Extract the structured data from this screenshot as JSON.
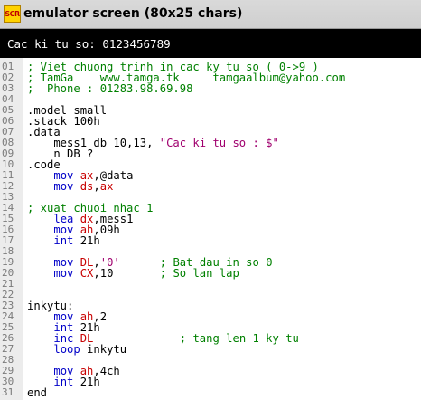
{
  "window": {
    "icon_text": "SCR",
    "title": "emulator screen (80x25 chars)"
  },
  "console": {
    "output": "Cac ki tu so: 0123456789"
  },
  "editor": {
    "lines": [
      {
        "n": "01",
        "tokens": [
          {
            "t": "; Viet chuong trinh in cac ky tu so ( 0->9 )",
            "c": "cmt"
          }
        ]
      },
      {
        "n": "02",
        "tokens": [
          {
            "t": "; TamGa    www.tamga.tk     tamgaalbum@yahoo.com",
            "c": "cmt"
          }
        ]
      },
      {
        "n": "03",
        "tokens": [
          {
            "t": ";  Phone : 01283.98.69.98",
            "c": "cmt"
          }
        ]
      },
      {
        "n": "04",
        "tokens": []
      },
      {
        "n": "05",
        "tokens": [
          {
            "t": ".model small",
            "c": "plain"
          }
        ]
      },
      {
        "n": "06",
        "tokens": [
          {
            "t": ".stack 100h",
            "c": "plain"
          }
        ]
      },
      {
        "n": "07",
        "tokens": [
          {
            "t": ".data",
            "c": "plain"
          }
        ]
      },
      {
        "n": "08",
        "tokens": [
          {
            "t": "    mess1 db 10,13, ",
            "c": "plain"
          },
          {
            "t": "\"Cac ki tu so : $\"",
            "c": "str"
          }
        ]
      },
      {
        "n": "09",
        "tokens": [
          {
            "t": "    n DB ?",
            "c": "plain"
          }
        ]
      },
      {
        "n": "10",
        "tokens": [
          {
            "t": ".code",
            "c": "plain"
          }
        ]
      },
      {
        "n": "11",
        "tokens": [
          {
            "t": "    ",
            "c": "plain"
          },
          {
            "t": "mov",
            "c": "kw"
          },
          {
            "t": " ",
            "c": "plain"
          },
          {
            "t": "ax",
            "c": "reg"
          },
          {
            "t": ",@data",
            "c": "plain"
          }
        ]
      },
      {
        "n": "12",
        "tokens": [
          {
            "t": "    ",
            "c": "plain"
          },
          {
            "t": "mov",
            "c": "kw"
          },
          {
            "t": " ",
            "c": "plain"
          },
          {
            "t": "ds",
            "c": "reg"
          },
          {
            "t": ",",
            "c": "plain"
          },
          {
            "t": "ax",
            "c": "reg"
          }
        ]
      },
      {
        "n": "13",
        "tokens": []
      },
      {
        "n": "14",
        "tokens": [
          {
            "t": "; xuat chuoi nhac 1",
            "c": "cmt"
          }
        ]
      },
      {
        "n": "15",
        "tokens": [
          {
            "t": "    ",
            "c": "plain"
          },
          {
            "t": "lea",
            "c": "kw"
          },
          {
            "t": " ",
            "c": "plain"
          },
          {
            "t": "dx",
            "c": "reg"
          },
          {
            "t": ",mess1",
            "c": "plain"
          }
        ]
      },
      {
        "n": "16",
        "tokens": [
          {
            "t": "    ",
            "c": "plain"
          },
          {
            "t": "mov",
            "c": "kw"
          },
          {
            "t": " ",
            "c": "plain"
          },
          {
            "t": "ah",
            "c": "reg"
          },
          {
            "t": ",09h",
            "c": "plain"
          }
        ]
      },
      {
        "n": "17",
        "tokens": [
          {
            "t": "    ",
            "c": "plain"
          },
          {
            "t": "int",
            "c": "kw"
          },
          {
            "t": " 21h",
            "c": "plain"
          }
        ]
      },
      {
        "n": "18",
        "tokens": []
      },
      {
        "n": "19",
        "tokens": [
          {
            "t": "    ",
            "c": "plain"
          },
          {
            "t": "mov",
            "c": "kw"
          },
          {
            "t": " ",
            "c": "plain"
          },
          {
            "t": "DL",
            "c": "reg"
          },
          {
            "t": ",",
            "c": "plain"
          },
          {
            "t": "'0'",
            "c": "str"
          },
          {
            "t": "      ",
            "c": "plain"
          },
          {
            "t": "; Bat dau in so 0",
            "c": "cmt"
          }
        ]
      },
      {
        "n": "20",
        "tokens": [
          {
            "t": "    ",
            "c": "plain"
          },
          {
            "t": "mov",
            "c": "kw"
          },
          {
            "t": " ",
            "c": "plain"
          },
          {
            "t": "CX",
            "c": "reg"
          },
          {
            "t": ",10       ",
            "c": "plain"
          },
          {
            "t": "; So lan lap",
            "c": "cmt"
          }
        ]
      },
      {
        "n": "21",
        "tokens": []
      },
      {
        "n": "22",
        "tokens": []
      },
      {
        "n": "23",
        "tokens": [
          {
            "t": "inkytu:",
            "c": "plain"
          }
        ]
      },
      {
        "n": "24",
        "tokens": [
          {
            "t": "    ",
            "c": "plain"
          },
          {
            "t": "mov",
            "c": "kw"
          },
          {
            "t": " ",
            "c": "plain"
          },
          {
            "t": "ah",
            "c": "reg"
          },
          {
            "t": ",2",
            "c": "plain"
          }
        ]
      },
      {
        "n": "25",
        "tokens": [
          {
            "t": "    ",
            "c": "plain"
          },
          {
            "t": "int",
            "c": "kw"
          },
          {
            "t": " 21h",
            "c": "plain"
          }
        ]
      },
      {
        "n": "26",
        "tokens": [
          {
            "t": "    ",
            "c": "plain"
          },
          {
            "t": "inc",
            "c": "kw"
          },
          {
            "t": " ",
            "c": "plain"
          },
          {
            "t": "DL",
            "c": "reg"
          },
          {
            "t": "             ",
            "c": "plain"
          },
          {
            "t": "; tang len 1 ky tu",
            "c": "cmt"
          }
        ]
      },
      {
        "n": "27",
        "tokens": [
          {
            "t": "    ",
            "c": "plain"
          },
          {
            "t": "loop",
            "c": "kw"
          },
          {
            "t": " inkytu",
            "c": "plain"
          }
        ]
      },
      {
        "n": "28",
        "tokens": []
      },
      {
        "n": "29",
        "tokens": [
          {
            "t": "    ",
            "c": "plain"
          },
          {
            "t": "mov",
            "c": "kw"
          },
          {
            "t": " ",
            "c": "plain"
          },
          {
            "t": "ah",
            "c": "reg"
          },
          {
            "t": ",4ch",
            "c": "plain"
          }
        ]
      },
      {
        "n": "30",
        "tokens": [
          {
            "t": "    ",
            "c": "plain"
          },
          {
            "t": "int",
            "c": "kw"
          },
          {
            "t": " 21h",
            "c": "plain"
          }
        ]
      },
      {
        "n": "31",
        "tokens": [
          {
            "t": "end",
            "c": "plain"
          }
        ]
      }
    ]
  },
  "colors": {
    "comment": "#008000",
    "keyword": "#0000c8",
    "register": "#c80000",
    "string": "#a0006e",
    "console_bg": "#000000"
  }
}
